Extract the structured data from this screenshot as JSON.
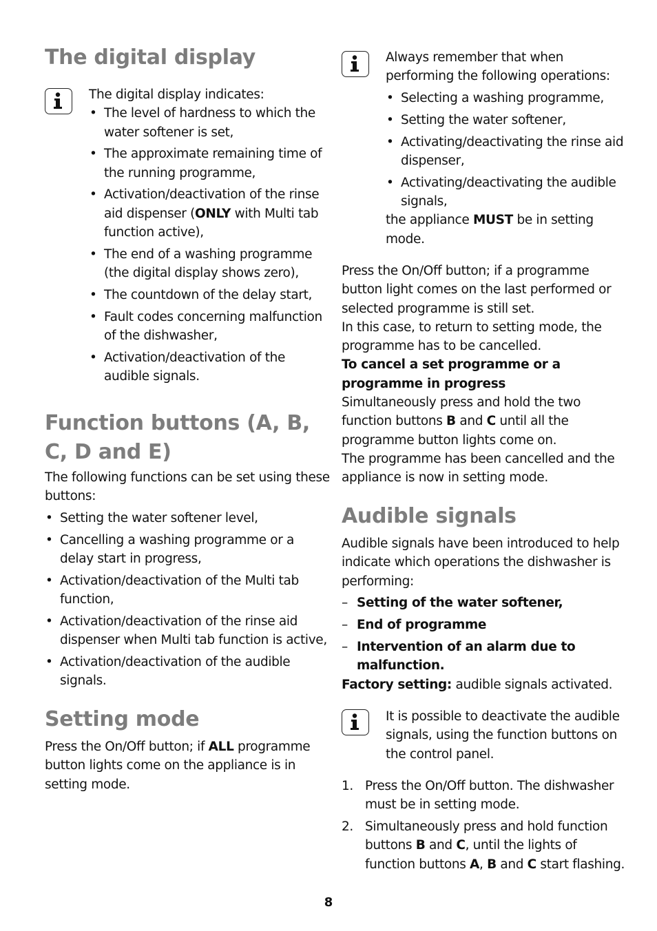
{
  "page_number": "8",
  "left": {
    "digital_display": {
      "title": "The digital display",
      "info_icon": "info-icon",
      "intro": "The digital display indicates:",
      "items": [
        {
          "pre": "The level of hardness to which the water softener is set,"
        },
        {
          "pre": "The approximate remaining time of the running programme,"
        },
        {
          "pre": "Activation/deactivation of the rinse aid dispenser (",
          "bold": "ONLY",
          "post": " with Multi tab function active),"
        },
        {
          "pre": "The end of a washing programme (the digital display shows zero),"
        },
        {
          "pre": "The countdown of the delay start,"
        },
        {
          "pre": "Fault codes concerning malfunction of the dishwasher,"
        },
        {
          "pre": "Activation/deactivation of the audible signals."
        }
      ]
    },
    "function_buttons": {
      "title": "Function buttons (A, B, C, D and E)",
      "intro": "The following functions can be set using these buttons:",
      "items": [
        "Setting the water softener level,",
        "Cancelling a washing programme or a delay start in progress,",
        "Activation/deactivation of the Multi tab function,",
        "Activation/deactivation of the rinse aid dispenser when Multi tab function is active,",
        "Activation/deactivation of the audible signals."
      ]
    },
    "setting_mode": {
      "title": "Setting mode",
      "text_pre": "Press the On/Off button; if ",
      "text_bold": "ALL",
      "text_post": " programme button lights come on the appliance is in setting mode."
    }
  },
  "right": {
    "note": {
      "info_icon": "info-icon",
      "intro": "Always remember that when performing the following operations:",
      "items": [
        "Selecting a washing programme,",
        "Setting the water softener,",
        "Activating/deactivating the rinse aid dispenser,",
        "Activating/deactivating the audible signals,"
      ],
      "outro_pre": "the appliance ",
      "outro_bold": "MUST",
      "outro_post": " be in setting mode."
    },
    "on_off_para": "Press the On/Off button; if a programme button light comes on the last performed or selected programme is still set.",
    "case_para": "In this case, to return to setting mode, the programme has to be cancelled.",
    "cancel_heading": "To cancel a set programme or a programme in progress",
    "cancel_text": {
      "pre": "Simultaneously press and hold the two function buttons ",
      "b1": "B",
      "mid": " and ",
      "b2": "C",
      "post": " until all the programme button lights come on."
    },
    "cancelled_para": "The programme has been cancelled and the appliance is now in setting mode.",
    "audible_signals": {
      "title": "Audible signals",
      "intro": "Audible signals have been introduced to help indicate which operations the dishwasher is performing:",
      "items": [
        "Setting of the water softener,",
        "End of programme",
        "Intervention of an alarm due to malfunction."
      ],
      "factory_label": "Factory setting:",
      "factory_value": " audible signals activated."
    },
    "note2": {
      "info_icon": "info-icon",
      "text": "It is possible to deactivate the audible signals, using the function buttons on the control panel."
    },
    "steps": [
      {
        "num": "1.",
        "text": "Press the On/Off button. The dishwasher must be in setting mode."
      },
      {
        "num": "2.",
        "pre": "Simultaneously press and hold function buttons ",
        "b1": "B",
        "m1": " and ",
        "b2": "C",
        "m2": ", until the lights of function buttons ",
        "b3": "A",
        "m3": ", ",
        "b4": "B",
        "m4": " and ",
        "b5": "C",
        "post": " start flashing."
      }
    ]
  }
}
